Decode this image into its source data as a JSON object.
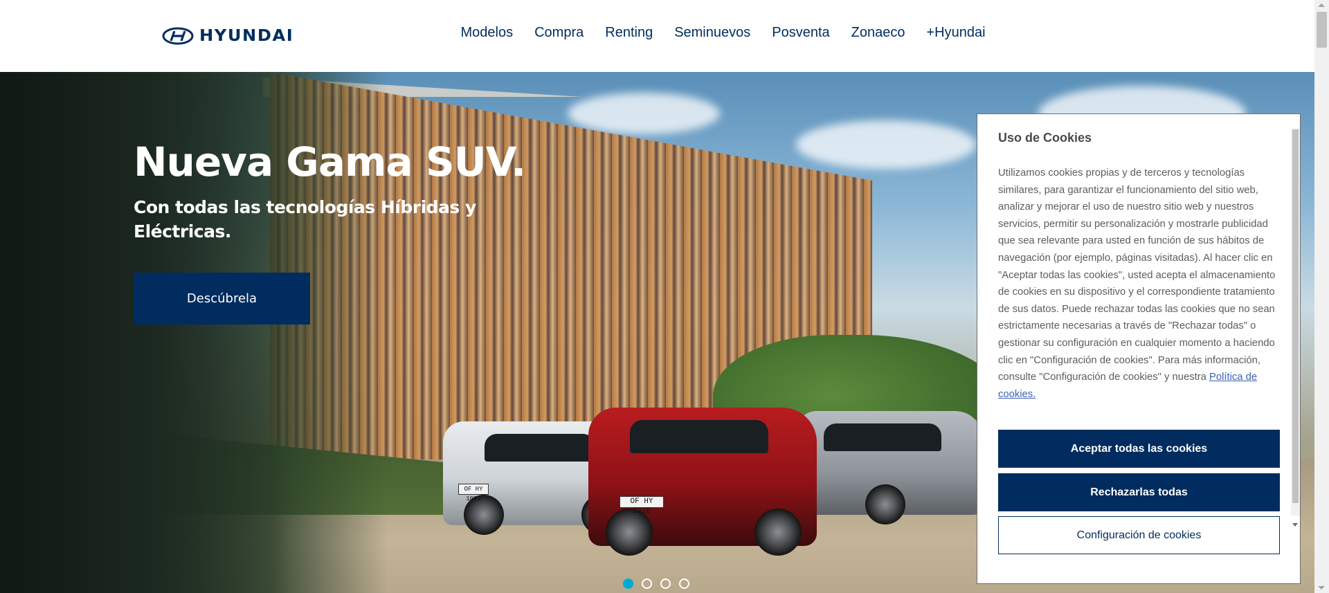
{
  "brand": {
    "logo_text": "HYUNDAI"
  },
  "nav": {
    "items": [
      "Modelos",
      "Compra",
      "Renting",
      "Seminuevos",
      "Posventa",
      "Zonaeco",
      "+Hyundai"
    ]
  },
  "hero": {
    "title": "Nueva Gama SUV.",
    "subtitle": "Con todas las tecnologías Híbridas y Eléctricas.",
    "cta_label": "Descúbrela",
    "plates": [
      "OF HY 292E",
      "OF HY 1002"
    ],
    "slides": {
      "total": 4,
      "active": 1
    }
  },
  "cookies": {
    "title": "Uso de Cookies",
    "body": "Utilizamos cookies propias y de terceros y tecnologías similares, para garantizar el funcionamiento del sitio web, analizar y mejorar el uso de nuestro sitio web y nuestros servicios, permitir su personalización y mostrarle publicidad que sea relevante para usted en función de sus hábitos de navegación (por ejemplo, páginas visitadas). Al hacer clic en \"Aceptar todas las cookies\", usted acepta el almacenamiento de cookies en su dispositivo y el correspondiente tratamiento de sus datos. Puede rechazar todas las cookies que no sean estrictamente necesarias a través de \"Rechazar todas\" o gestionar su configuración en cualquier momento a haciendo clic en \"Configuración de cookies\". Para más información, consulte \"Configuración de cookies\" y nuestra",
    "policy_link": "Política de cookies.",
    "accept_label": "Aceptar todas las cookies",
    "reject_label": "Rechazarlas todas",
    "config_label": "Configuración de cookies"
  },
  "colors": {
    "brand_navy": "#002c5f",
    "active_dot": "#00aad2",
    "link": "#3a5fb0"
  }
}
